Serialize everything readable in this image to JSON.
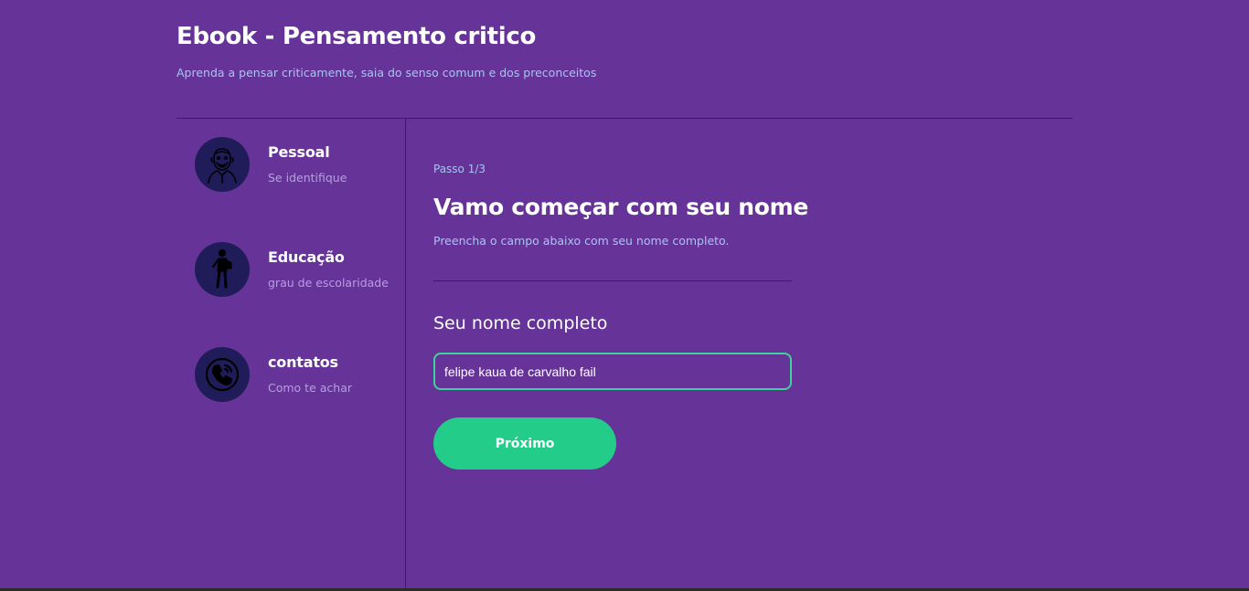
{
  "header": {
    "title": "Ebook - Pensamento critico",
    "subtitle": "Aprenda a pensar criticamente, saia do senso comum e dos preconceitos"
  },
  "sidebar": {
    "steps": [
      {
        "title": "Pessoal",
        "subtitle": "Se identifique",
        "icon": "thinker-icon"
      },
      {
        "title": "Educação",
        "subtitle": "grau de escolaridade",
        "icon": "student-icon"
      },
      {
        "title": "contatos",
        "subtitle": "Como te achar",
        "icon": "phone-icon"
      }
    ]
  },
  "main": {
    "step_counter": "Passo 1/3",
    "heading": "Vamo começar com seu nome",
    "hint": "Preencha o campo abaixo com seu nome completo.",
    "field_label": "Seu nome completo",
    "name_value": "felipe kaua de carvalho fail",
    "next_label": "Próximo"
  },
  "colors": {
    "background": "#663399",
    "avatar": "#201c5a",
    "accent": "#23cc88",
    "input_border": "#3ed39a",
    "muted_text": "#a7c6f0",
    "step_subtext": "#b79ee0",
    "divider": "#2c1f6b"
  }
}
